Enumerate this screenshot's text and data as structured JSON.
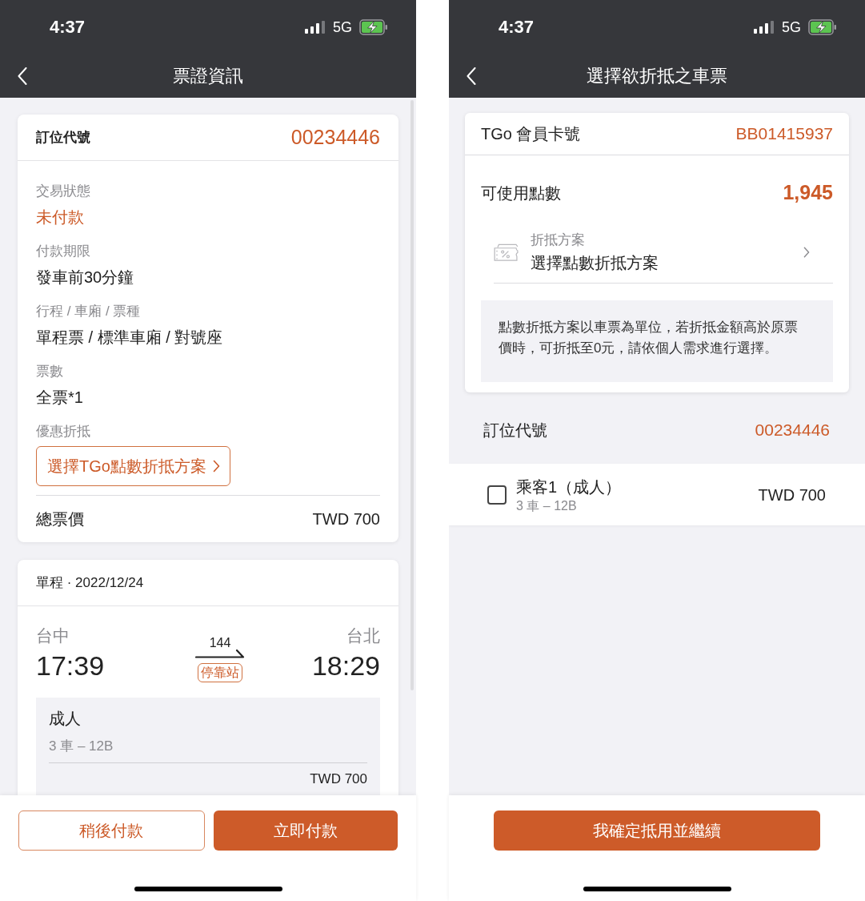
{
  "ticket_info_screen": {
    "status_bar": {
      "time": "4:37",
      "network": "5G"
    },
    "nav": {
      "title": "票證資訊"
    },
    "booking_card": {
      "label": "訂位代號",
      "value": "00234446",
      "fields": [
        {
          "label": "交易狀態",
          "value": "未付款",
          "kind": "status"
        },
        {
          "label": "付款期限",
          "value": "發車前30分鐘",
          "kind": "text"
        },
        {
          "label": "行程 / 車廂 / 票種",
          "value": "單程票 / 標準車廂 / 對號座",
          "kind": "text"
        },
        {
          "label": "票數",
          "value": "全票*1",
          "kind": "text"
        },
        {
          "label": "優惠折抵",
          "value": "選擇TGo點數折抵方案",
          "kind": "button"
        }
      ],
      "total": {
        "label": "總票價",
        "value": "TWD 700"
      }
    },
    "trip_card": {
      "title": "單程 · 2022/12/24",
      "origin": {
        "station": "台中",
        "time": "17:39"
      },
      "destination": {
        "station": "台北",
        "time": "18:29"
      },
      "train": "144",
      "stop_badge": "停靠站",
      "passenger": {
        "type": "成人",
        "seat": "3 車 – 12B",
        "price": "TWD 700"
      }
    },
    "actions": [
      {
        "label": "稍後付款",
        "kind": "outline"
      },
      {
        "label": "立即付款",
        "kind": "primary"
      }
    ]
  },
  "discount_screen": {
    "status_bar": {
      "time": "4:37",
      "network": "5G"
    },
    "nav": {
      "title": "選擇欲折抵之車票"
    },
    "member_card": {
      "label": "TGo 會員卡號",
      "value": "BB01415937",
      "points": {
        "label": "可使用點數",
        "value": "1,945"
      },
      "plan": {
        "label": "折抵方案",
        "value": "選擇點數折抵方案"
      },
      "notice": "點數折抵方案以車票為單位，若折抵金額高於原票價時，可折抵至0元，請依個人需求進行選擇。"
    },
    "booking": {
      "label": "訂位代號",
      "value": "00234446"
    },
    "passengers": [
      {
        "name": "乘客1（成人）",
        "seat": "3 車 – 12B",
        "price": "TWD 700",
        "checked": false
      }
    ],
    "actions": [
      {
        "label": "我確定抵用並繼續",
        "kind": "primary"
      }
    ]
  }
}
